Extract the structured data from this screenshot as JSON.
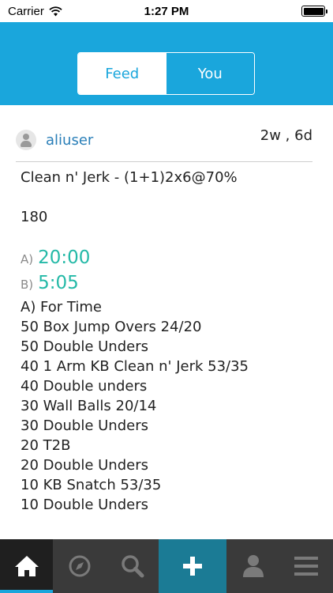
{
  "status_bar": {
    "carrier": "Carrier",
    "time": "1:27 PM",
    "wifi_icon": "wifi-icon",
    "battery_icon": "battery-full-icon"
  },
  "header": {
    "background": "#1aa6dc",
    "tabs": [
      {
        "label": "Feed",
        "selected": true
      },
      {
        "label": "You",
        "selected": false
      }
    ]
  },
  "post": {
    "username": "aliuser",
    "time_ago": "2w , 6d",
    "title": "Clean n' Jerk - (1+1)2x6@70%",
    "score": "180",
    "results": [
      {
        "prefix": "A)",
        "value": "20:00"
      },
      {
        "prefix": "B)",
        "value": "5:05"
      }
    ],
    "description": [
      "A) For Time",
      "50 Box Jump Overs 24/20",
      "50 Double Unders",
      "40 1 Arm KB Clean n' Jerk 53/35",
      "40 Double unders",
      "30 Wall Balls 20/14",
      "30 Double Unders",
      "20 T2B",
      "20 Double Unders",
      "10 KB Snatch 53/35",
      "10 Double Unders"
    ],
    "accent_color": "#24b9a7",
    "username_color": "#2a7fb8"
  },
  "tab_bar": {
    "items": [
      {
        "icon": "home-icon",
        "active": true
      },
      {
        "icon": "compass-icon",
        "active": false
      },
      {
        "icon": "search-icon",
        "active": false
      },
      {
        "icon": "add-icon",
        "active": false
      },
      {
        "icon": "profile-icon",
        "active": false
      },
      {
        "icon": "menu-icon",
        "active": false
      }
    ],
    "active_color": "#1aa6dc"
  }
}
